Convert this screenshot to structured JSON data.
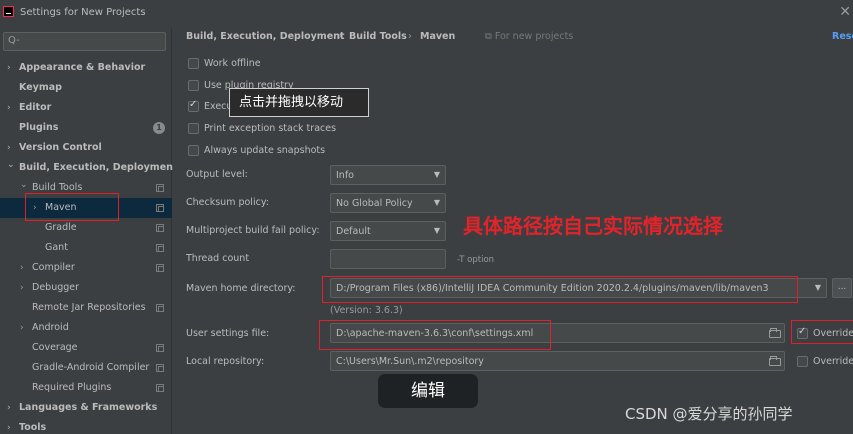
{
  "window": {
    "title": "Settings for New Projects"
  },
  "search": {
    "placeholder": "Q-"
  },
  "sidebar": {
    "items": [
      {
        "label": "Appearance & Behavior",
        "arrow": "›",
        "bold": true
      },
      {
        "label": "Keymap",
        "bold": true
      },
      {
        "label": "Editor",
        "arrow": "›",
        "bold": true
      },
      {
        "label": "Plugins",
        "bold": true,
        "badge": "1"
      },
      {
        "label": "Version Control",
        "arrow": "›",
        "bold": true
      },
      {
        "label": "Build, Execution, Deployment",
        "arrow": "⌄",
        "bold": true
      },
      {
        "label": "Build Tools",
        "arrow": "⌄"
      },
      {
        "label": "Maven",
        "arrow": "›"
      },
      {
        "label": "Gradle"
      },
      {
        "label": "Gant"
      },
      {
        "label": "Compiler",
        "arrow": "›"
      },
      {
        "label": "Debugger",
        "arrow": "›"
      },
      {
        "label": "Remote Jar Repositories"
      },
      {
        "label": "Android",
        "arrow": "›"
      },
      {
        "label": "Coverage"
      },
      {
        "label": "Gradle-Android Compiler"
      },
      {
        "label": "Required Plugins"
      },
      {
        "label": "Languages & Frameworks",
        "arrow": "›",
        "bold": true
      },
      {
        "label": "Tools",
        "arrow": "›",
        "bold": true
      }
    ]
  },
  "breadcrumb": {
    "items": [
      "Build, Execution, Deployment",
      "Build Tools",
      "Maven"
    ],
    "separator": "›",
    "scope": "For new projects",
    "reset": "Rese"
  },
  "options": [
    {
      "label": "Work offline",
      "checked": false
    },
    {
      "label": "Use plugin registry",
      "checked": false
    },
    {
      "label": "Execute goals recursively",
      "checked": true
    },
    {
      "label": "Print exception stack traces",
      "checked": false
    },
    {
      "label": "Always update snapshots",
      "checked": false
    }
  ],
  "fields": {
    "output_level": {
      "label": "Output level:",
      "value": "Info"
    },
    "checksum_policy": {
      "label": "Checksum policy:",
      "value": "No Global Policy"
    },
    "fail_policy": {
      "label": "Multiproject build fail policy:",
      "value": "Default"
    },
    "thread_count": {
      "label": "Thread count",
      "value": "",
      "hint": "-T option"
    },
    "maven_home": {
      "label": "Maven home directory:",
      "value": "D:/Program Files (x86)/IntelliJ IDEA Community Edition 2020.2.4/plugins/maven/lib/maven3",
      "version": "(Version: 3.6.3)"
    },
    "user_settings": {
      "label": "User settings file:",
      "value": "D:\\apache-maven-3.6.3\\conf\\settings.xml",
      "override": "Override",
      "override_checked": true
    },
    "local_repo": {
      "label": "Local repository:",
      "value": "C:\\Users\\Mr.Sun\\.m2\\repository",
      "override": "Override",
      "override_checked": false
    }
  },
  "overlays": {
    "drag_tooltip": "点击并拖拽以移动",
    "annotation": "具体路径按自己实际情况选择",
    "edit_button": "编辑",
    "watermark": "CSDN @爱分享的孙同学"
  },
  "colors": {
    "annotation": "#e3232a",
    "selected_row": "#0d293e",
    "link": "#589df6"
  }
}
